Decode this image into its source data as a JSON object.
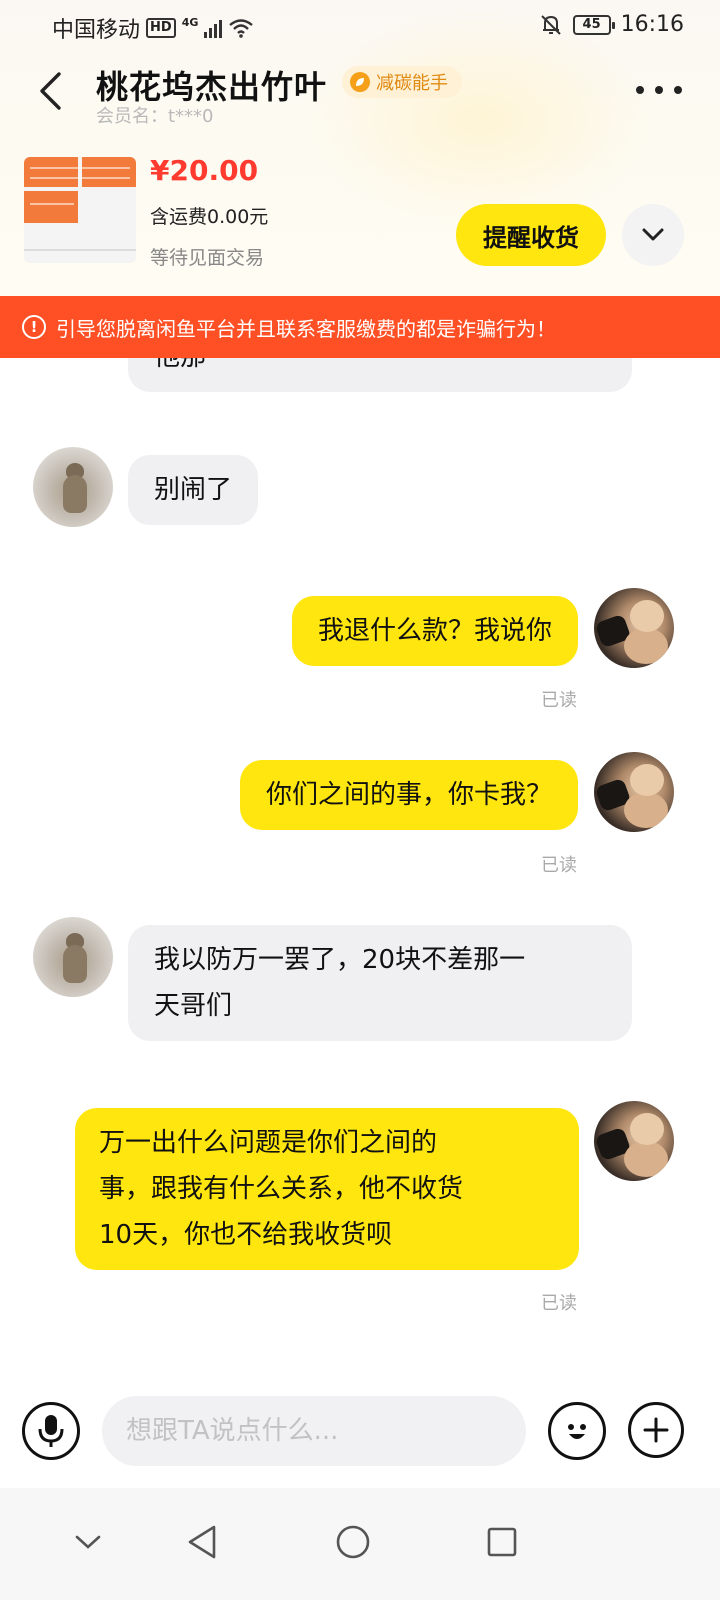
{
  "status_bar": {
    "carrier": "中国移动",
    "hd": "HD",
    "network": "4G",
    "battery": "45",
    "time": "16:16"
  },
  "header": {
    "title": "桃花坞杰出竹叶",
    "badge_label": "减碳能手",
    "member_label": "会员名：t***0"
  },
  "product": {
    "price": "¥20.00",
    "shipping": "含运费0.00元",
    "status": "等待见面交易",
    "remind_button": "提醒收货"
  },
  "warning": {
    "text": "引导您脱离闲鱼平台并且联系客服缴费的都是诈骗行为！"
  },
  "messages": [
    {
      "side": "in",
      "text": "他那"
    },
    {
      "side": "in",
      "text": "别闹了"
    },
    {
      "side": "out",
      "text": "我退什么款？我说你",
      "read": "已读"
    },
    {
      "side": "out",
      "text": "你们之间的事，你卡我？",
      "read": "已读"
    },
    {
      "side": "in",
      "line1": "我以防万一罢了，20块不差那一",
      "line2": "天哥们"
    },
    {
      "side": "out",
      "line1": "万一出什么问题是你们之间的",
      "line2": "事，跟我有什么关系，他不收货",
      "line3": "10天，你也不给我收货呗",
      "read": "已读"
    }
  ],
  "input": {
    "placeholder": "想跟TA说点什么..."
  },
  "colors": {
    "accent_yellow": "#ffe60f",
    "warning_red": "#ff4f25",
    "price_red": "#ff3a2f"
  }
}
